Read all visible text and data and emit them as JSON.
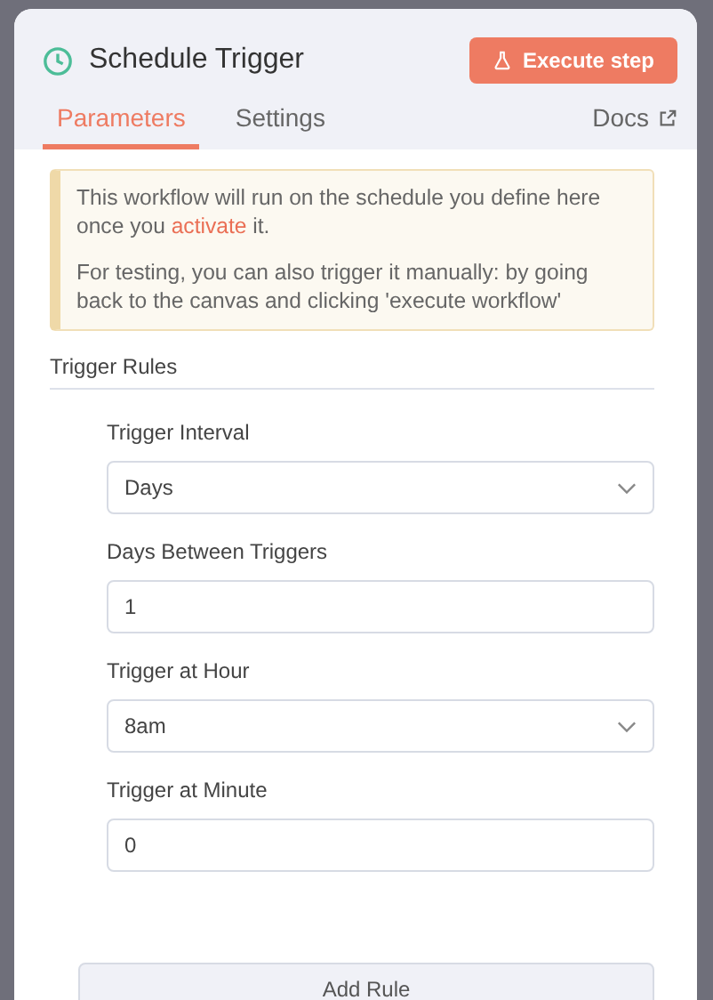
{
  "header": {
    "title": "Schedule Trigger",
    "execute_button": "Execute step"
  },
  "tabs": [
    {
      "label": "Parameters",
      "selected": true
    },
    {
      "label": "Settings",
      "selected": false
    }
  ],
  "docs_link": "Docs",
  "notice": {
    "paragraphs": [
      "This workflow will run on the schedule you define here once you **activate** it.",
      "For testing, you can also trigger it manually: by going back to the canvas and clicking 'execute workflow'"
    ]
  },
  "section_title": "Trigger Rules",
  "fields": [
    {
      "label": "Trigger Interval",
      "kind": "select",
      "value": "Days"
    },
    {
      "label": "Days Between Triggers",
      "kind": "input",
      "value": "1"
    },
    {
      "label": "Trigger at Hour",
      "kind": "select",
      "value": "8am"
    },
    {
      "label": "Trigger at Minute",
      "kind": "input",
      "value": "0"
    }
  ],
  "add_button": "Add Rule"
}
